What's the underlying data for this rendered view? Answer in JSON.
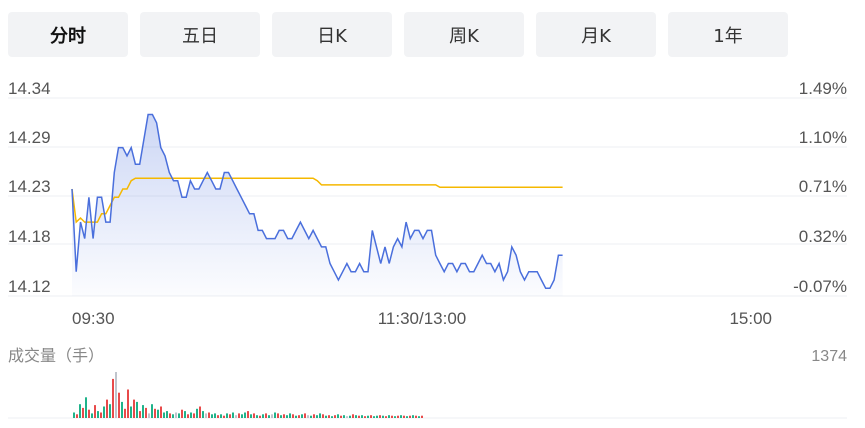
{
  "tabs": [
    {
      "label": "分时",
      "active": true
    },
    {
      "label": "五日",
      "active": false
    },
    {
      "label": "日K",
      "active": false
    },
    {
      "label": "周K",
      "active": false
    },
    {
      "label": "月K",
      "active": false
    },
    {
      "label": "1年",
      "active": false
    }
  ],
  "colors": {
    "price_line": "#4a6fdc",
    "avg_line": "#f5b800",
    "vol_up": "#e84a4a",
    "vol_down": "#1fb38a",
    "vol_flat": "#c0c4cc"
  },
  "chart_data": {
    "type": "line",
    "price_ticks": [
      "14.34",
      "14.29",
      "14.23",
      "14.18",
      "14.12"
    ],
    "pct_ticks": [
      "1.49%",
      "1.10%",
      "0.71%",
      "0.32%",
      "-0.07%"
    ],
    "x_ticks": [
      "09:30",
      "11:30/13:00",
      "15:00"
    ],
    "ylim": [
      14.12,
      14.34
    ],
    "volume_label": "成交量（手）",
    "volume_max": "1374",
    "series": [
      {
        "values": [
          14.23,
          14.13,
          14.19,
          14.17,
          14.22,
          14.17,
          14.22,
          14.22,
          14.19,
          14.19,
          14.25,
          14.28,
          14.28,
          14.27,
          14.28,
          14.26,
          14.26,
          14.29,
          14.32,
          14.32,
          14.31,
          14.28,
          14.27,
          14.25,
          14.24,
          14.24,
          14.22,
          14.22,
          14.24,
          14.23,
          14.23,
          14.24,
          14.25,
          14.24,
          14.23,
          14.23,
          14.25,
          14.25,
          14.24,
          14.23,
          14.22,
          14.21,
          14.2,
          14.2,
          14.18,
          14.18,
          14.17,
          14.17,
          14.17,
          14.18,
          14.18,
          14.17,
          14.17,
          14.18,
          14.19,
          14.18,
          14.17,
          14.18,
          14.17,
          14.16,
          14.16,
          14.14,
          14.13,
          14.12,
          14.13,
          14.14,
          14.13,
          14.13,
          14.14,
          14.13,
          14.13,
          14.18,
          14.16,
          14.14,
          14.16,
          14.14,
          14.16,
          14.17,
          14.16,
          14.19,
          14.17,
          14.18,
          14.18,
          14.17,
          14.18,
          14.18,
          14.15,
          14.14,
          14.13,
          14.14,
          14.14,
          14.13,
          14.14,
          14.14,
          14.13,
          14.13,
          14.14,
          14.15,
          14.14,
          14.14,
          14.13,
          14.14,
          14.12,
          14.13,
          14.16,
          14.15,
          14.13,
          14.12,
          14.13,
          14.13,
          14.13,
          14.12,
          14.11,
          14.11,
          14.12,
          14.15,
          14.15
        ]
      },
      {
        "values": [
          14.23,
          14.19,
          14.195,
          14.19,
          14.19,
          14.19,
          14.19,
          14.2,
          14.2,
          14.21,
          14.22,
          14.22,
          14.23,
          14.23,
          14.24,
          14.243,
          14.243,
          14.243,
          14.243,
          14.243,
          14.243,
          14.243,
          14.243,
          14.243,
          14.243,
          14.243,
          14.243,
          14.243,
          14.243,
          14.243,
          14.243,
          14.243,
          14.243,
          14.243,
          14.243,
          14.243,
          14.243,
          14.243,
          14.243,
          14.243,
          14.243,
          14.243,
          14.243,
          14.243,
          14.243,
          14.243,
          14.243,
          14.243,
          14.243,
          14.243,
          14.243,
          14.243,
          14.243,
          14.243,
          14.243,
          14.243,
          14.243,
          14.243,
          14.24,
          14.235,
          14.235,
          14.235,
          14.235,
          14.235,
          14.235,
          14.235,
          14.235,
          14.235,
          14.235,
          14.235,
          14.235,
          14.235,
          14.235,
          14.235,
          14.235,
          14.235,
          14.235,
          14.235,
          14.235,
          14.235,
          14.235,
          14.235,
          14.235,
          14.235,
          14.235,
          14.235,
          14.235,
          14.232,
          14.232,
          14.232,
          14.232,
          14.232,
          14.232,
          14.232,
          14.232,
          14.232,
          14.232,
          14.232,
          14.232,
          14.232,
          14.232,
          14.232,
          14.232,
          14.232,
          14.232,
          14.232,
          14.232,
          14.232,
          14.232,
          14.232,
          14.232,
          14.232,
          14.232,
          14.232,
          14.232,
          14.232,
          14.232
        ]
      }
    ],
    "volume": [
      {
        "v": 0.12,
        "c": "down"
      },
      {
        "v": 0.08,
        "c": "up"
      },
      {
        "v": 0.3,
        "c": "down"
      },
      {
        "v": 0.22,
        "c": "up"
      },
      {
        "v": 0.45,
        "c": "down"
      },
      {
        "v": 0.18,
        "c": "up"
      },
      {
        "v": 0.1,
        "c": "down"
      },
      {
        "v": 0.28,
        "c": "up"
      },
      {
        "v": 0.15,
        "c": "down"
      },
      {
        "v": 0.12,
        "c": "up"
      },
      {
        "v": 0.25,
        "c": "down"
      },
      {
        "v": 0.4,
        "c": "up"
      },
      {
        "v": 0.3,
        "c": "down"
      },
      {
        "v": 0.85,
        "c": "up"
      },
      {
        "v": 1.0,
        "c": "flat"
      },
      {
        "v": 0.55,
        "c": "up"
      },
      {
        "v": 0.35,
        "c": "down"
      },
      {
        "v": 0.2,
        "c": "up"
      },
      {
        "v": 0.62,
        "c": "up"
      },
      {
        "v": 0.25,
        "c": "down"
      },
      {
        "v": 0.4,
        "c": "up"
      },
      {
        "v": 0.35,
        "c": "down"
      },
      {
        "v": 0.15,
        "c": "up"
      },
      {
        "v": 0.28,
        "c": "down"
      },
      {
        "v": 0.22,
        "c": "up"
      },
      {
        "v": 0.1,
        "c": "flat"
      },
      {
        "v": 0.3,
        "c": "down"
      },
      {
        "v": 0.2,
        "c": "up"
      },
      {
        "v": 0.18,
        "c": "down"
      },
      {
        "v": 0.25,
        "c": "up"
      },
      {
        "v": 0.12,
        "c": "down"
      },
      {
        "v": 0.15,
        "c": "down"
      },
      {
        "v": 0.1,
        "c": "up"
      },
      {
        "v": 0.08,
        "c": "down"
      },
      {
        "v": 0.12,
        "c": "flat"
      },
      {
        "v": 0.1,
        "c": "down"
      },
      {
        "v": 0.18,
        "c": "up"
      },
      {
        "v": 0.15,
        "c": "down"
      },
      {
        "v": 0.08,
        "c": "up"
      },
      {
        "v": 0.12,
        "c": "down"
      },
      {
        "v": 0.1,
        "c": "up"
      },
      {
        "v": 0.2,
        "c": "down"
      },
      {
        "v": 0.25,
        "c": "up"
      },
      {
        "v": 0.15,
        "c": "down"
      },
      {
        "v": 0.1,
        "c": "flat"
      },
      {
        "v": 0.12,
        "c": "up"
      },
      {
        "v": 0.08,
        "c": "down"
      },
      {
        "v": 0.1,
        "c": "down"
      },
      {
        "v": 0.06,
        "c": "up"
      },
      {
        "v": 0.08,
        "c": "down"
      },
      {
        "v": 0.05,
        "c": "up"
      },
      {
        "v": 0.1,
        "c": "down"
      },
      {
        "v": 0.08,
        "c": "up"
      },
      {
        "v": 0.12,
        "c": "down"
      },
      {
        "v": 0.06,
        "c": "flat"
      },
      {
        "v": 0.1,
        "c": "up"
      },
      {
        "v": 0.08,
        "c": "down"
      },
      {
        "v": 0.12,
        "c": "down"
      },
      {
        "v": 0.15,
        "c": "up"
      },
      {
        "v": 0.08,
        "c": "down"
      },
      {
        "v": 0.1,
        "c": "up"
      },
      {
        "v": 0.06,
        "c": "down"
      },
      {
        "v": 0.05,
        "c": "up"
      },
      {
        "v": 0.08,
        "c": "down"
      },
      {
        "v": 0.1,
        "c": "up"
      },
      {
        "v": 0.06,
        "c": "down"
      },
      {
        "v": 0.08,
        "c": "flat"
      },
      {
        "v": 0.12,
        "c": "down"
      },
      {
        "v": 0.1,
        "c": "up"
      },
      {
        "v": 0.06,
        "c": "down"
      },
      {
        "v": 0.08,
        "c": "up"
      },
      {
        "v": 0.06,
        "c": "down"
      },
      {
        "v": 0.1,
        "c": "down"
      },
      {
        "v": 0.08,
        "c": "up"
      },
      {
        "v": 0.05,
        "c": "down"
      },
      {
        "v": 0.06,
        "c": "up"
      },
      {
        "v": 0.08,
        "c": "down"
      },
      {
        "v": 0.1,
        "c": "up"
      },
      {
        "v": 0.06,
        "c": "flat"
      },
      {
        "v": 0.05,
        "c": "down"
      },
      {
        "v": 0.08,
        "c": "up"
      },
      {
        "v": 0.06,
        "c": "down"
      },
      {
        "v": 0.1,
        "c": "down"
      },
      {
        "v": 0.08,
        "c": "up"
      },
      {
        "v": 0.05,
        "c": "down"
      },
      {
        "v": 0.06,
        "c": "up"
      },
      {
        "v": 0.04,
        "c": "down"
      },
      {
        "v": 0.06,
        "c": "up"
      },
      {
        "v": 0.08,
        "c": "down"
      },
      {
        "v": 0.05,
        "c": "up"
      },
      {
        "v": 0.06,
        "c": "down"
      },
      {
        "v": 0.04,
        "c": "flat"
      },
      {
        "v": 0.05,
        "c": "down"
      },
      {
        "v": 0.08,
        "c": "up"
      },
      {
        "v": 0.06,
        "c": "down"
      },
      {
        "v": 0.05,
        "c": "up"
      },
      {
        "v": 0.06,
        "c": "down"
      },
      {
        "v": 0.04,
        "c": "up"
      },
      {
        "v": 0.05,
        "c": "down"
      },
      {
        "v": 0.06,
        "c": "up"
      },
      {
        "v": 0.04,
        "c": "down"
      },
      {
        "v": 0.05,
        "c": "down"
      },
      {
        "v": 0.06,
        "c": "up"
      },
      {
        "v": 0.05,
        "c": "down"
      },
      {
        "v": 0.04,
        "c": "up"
      },
      {
        "v": 0.06,
        "c": "down"
      },
      {
        "v": 0.05,
        "c": "up"
      },
      {
        "v": 0.04,
        "c": "down"
      },
      {
        "v": 0.05,
        "c": "up"
      },
      {
        "v": 0.06,
        "c": "down"
      },
      {
        "v": 0.05,
        "c": "up"
      },
      {
        "v": 0.04,
        "c": "down"
      },
      {
        "v": 0.05,
        "c": "up"
      },
      {
        "v": 0.06,
        "c": "down"
      },
      {
        "v": 0.05,
        "c": "up"
      },
      {
        "v": 0.04,
        "c": "down"
      },
      {
        "v": 0.05,
        "c": "up"
      }
    ]
  }
}
